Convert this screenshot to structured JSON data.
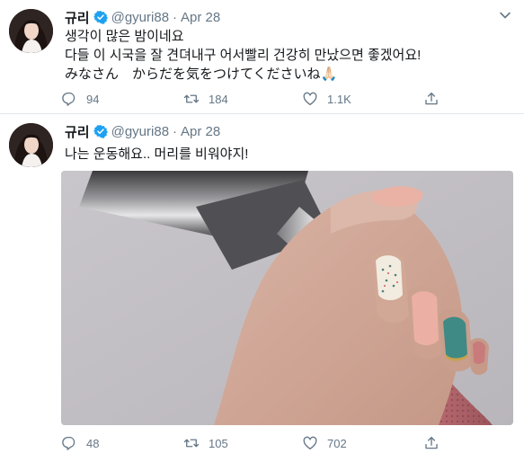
{
  "tweets": [
    {
      "author": {
        "name": "규리",
        "handle": "@gyuri88"
      },
      "separator": "·",
      "date": "Apr 28",
      "text": [
        "생각이 많은 밤이네요",
        "다들 이 시국을 잘 견뎌내구 어서빨리 건강히 만났으면 좋겠어요!",
        "みなさん　からだを気をつけてくださいね🙏🏻"
      ],
      "stats": {
        "replies": "94",
        "retweets": "184",
        "likes": "1.1K"
      }
    },
    {
      "author": {
        "name": "규리",
        "handle": "@gyuri88"
      },
      "separator": "·",
      "date": "Apr 28",
      "text": [
        "나는 운동해요.. 머리를 비워야지!"
      ],
      "stats": {
        "replies": "48",
        "retweets": "105",
        "likes": "702"
      }
    }
  ],
  "icons": {
    "verified": "verified-badge-icon",
    "menu": "chevron-down-icon",
    "reply": "reply-icon",
    "retweet": "retweet-icon",
    "like": "heart-icon",
    "share": "share-icon"
  },
  "colors": {
    "verified_blue": "#1da1f2",
    "secondary_text": "#657786",
    "divider": "#e1e8ed"
  }
}
